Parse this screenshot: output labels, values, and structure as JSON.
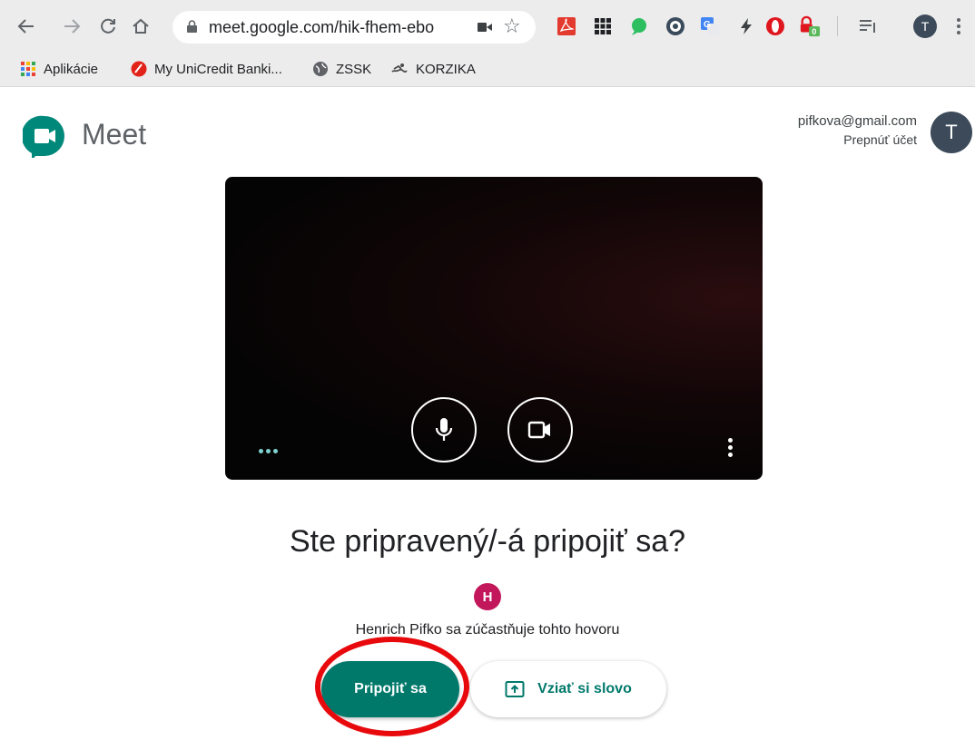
{
  "browser": {
    "url": "meet.google.com/hik-fhem-ebo",
    "profile_initial": "T",
    "extensions": [
      {
        "icon": "acrobat-icon",
        "color": "#e33a2f"
      },
      {
        "icon": "grid-app-icon",
        "color": "#202124"
      },
      {
        "icon": "evernote-icon",
        "color": "#2dbe60"
      },
      {
        "icon": "ghostery-icon",
        "color": "#3a4b5c"
      },
      {
        "icon": "translate-icon",
        "color": "#4285f4"
      },
      {
        "icon": "bolt-icon",
        "color": "#3c4043"
      },
      {
        "icon": "opera-icon",
        "color": "#e0161f"
      },
      {
        "icon": "lock-badge-icon",
        "color": "#e0161f",
        "badge": "0"
      },
      {
        "icon": "reading-list-icon",
        "color": "#5f6368"
      }
    ]
  },
  "bookmarks": [
    {
      "label": "Aplikácie",
      "icon": "apps-grid-icon"
    },
    {
      "label": "My UniCredit Banki...",
      "icon": "unicredit-icon"
    },
    {
      "label": "ZSSK",
      "icon": "globe-icon"
    },
    {
      "label": "KORZIKA",
      "icon": "swimmer-icon"
    }
  ],
  "meet": {
    "title": "Meet",
    "account_email": "pifkova@gmail.com",
    "switch_account": "Prepnúť účet",
    "account_initial": "T",
    "ready_heading": "Ste pripravený/-á pripojiť sa?",
    "participant_initial": "H",
    "participant_text": "Henrich Pifko sa zúčastňuje tohto hovoru",
    "join_label": "Pripojiť sa",
    "present_label": "Vziať si slovo"
  },
  "colors": {
    "accent": "#00796b",
    "annotation": "#e8090d",
    "participant_avatar": "#c2185b"
  }
}
